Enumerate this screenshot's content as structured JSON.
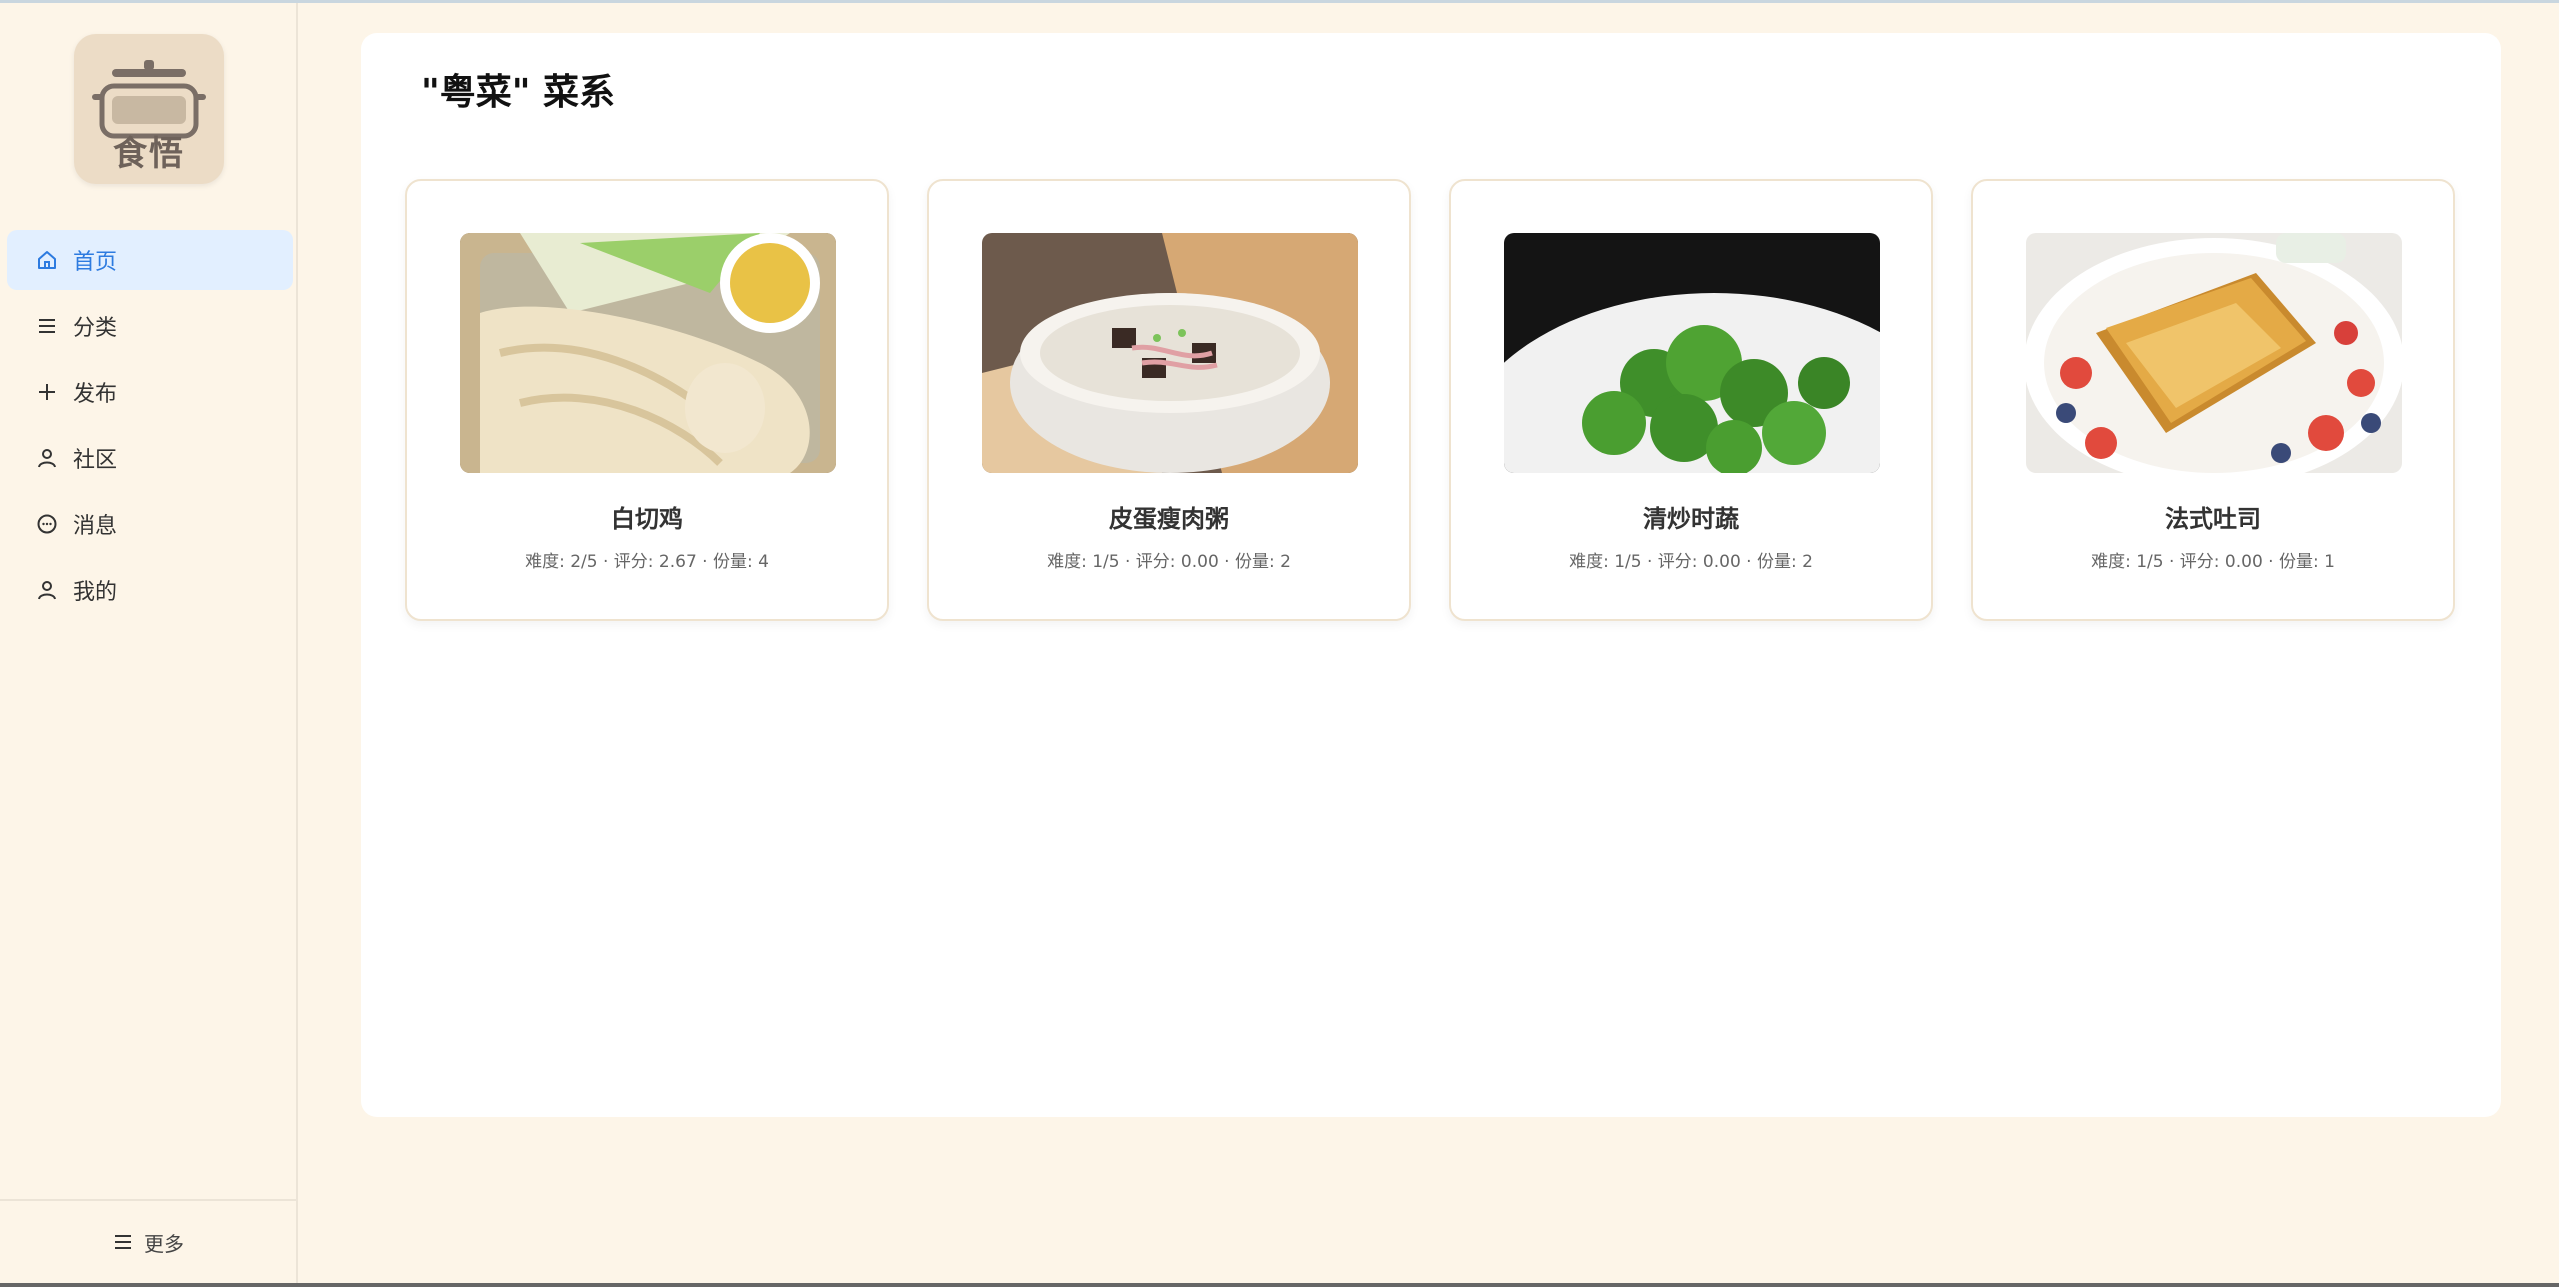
{
  "app": {
    "logo_text": "食悟"
  },
  "sidebar": {
    "items": [
      {
        "label": "首页",
        "icon": "home-icon"
      },
      {
        "label": "分类",
        "icon": "list-icon"
      },
      {
        "label": "发布",
        "icon": "plus-icon"
      },
      {
        "label": "社区",
        "icon": "user-icon"
      },
      {
        "label": "消息",
        "icon": "chat-icon"
      },
      {
        "label": "我的",
        "icon": "user-icon"
      }
    ],
    "more_label": "更多"
  },
  "main": {
    "title": "\"粤菜\" 菜系",
    "cards": [
      {
        "name": "白切鸡",
        "meta": "难度: 2/5 · 评分: 2.67 · 份量: 4"
      },
      {
        "name": "皮蛋瘦肉粥",
        "meta": "难度: 1/5 · 评分: 0.00 · 份量: 2"
      },
      {
        "name": "清炒时蔬",
        "meta": "难度: 1/5 · 评分: 0.00 · 份量: 2"
      },
      {
        "name": "法式吐司",
        "meta": "难度: 1/5 · 评分: 0.00 · 份量: 1"
      }
    ]
  },
  "colors": {
    "background": "#fdf5e8",
    "active_nav_bg": "#e2efff",
    "accent": "#2d7be0"
  }
}
